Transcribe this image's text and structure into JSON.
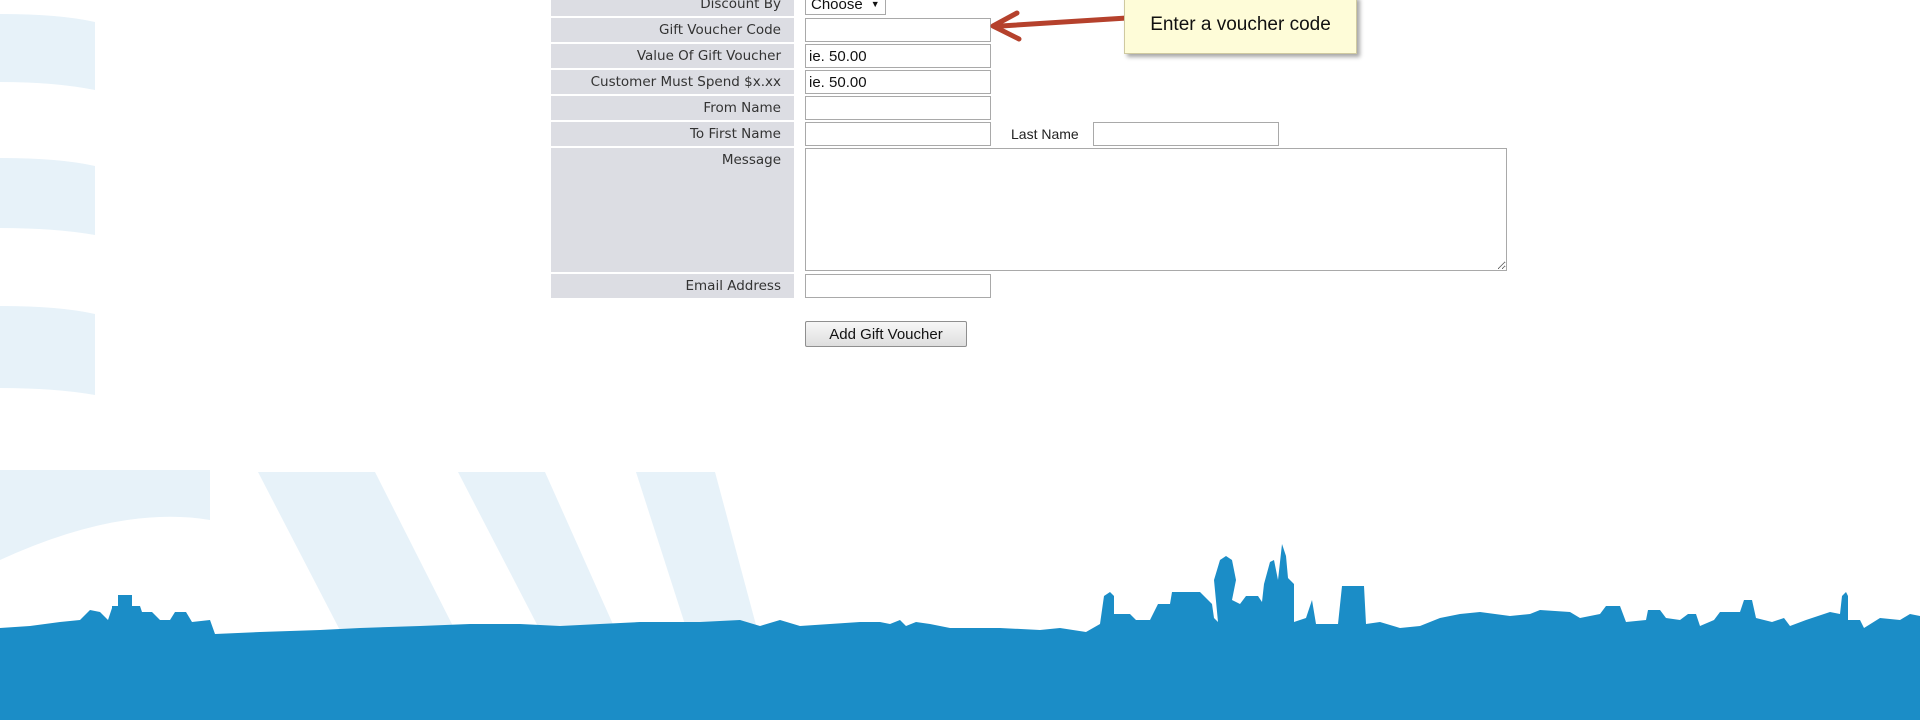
{
  "form": {
    "rows": [
      {
        "label": "Discount By",
        "select": "Choose"
      },
      {
        "label": "Gift Voucher Code",
        "value": ""
      },
      {
        "label": "Value Of Gift Voucher",
        "placeholder": "ie. 50.00"
      },
      {
        "label": "Customer Must Spend $x.xx",
        "placeholder": "ie. 50.00"
      },
      {
        "label": "From Name",
        "value": ""
      },
      {
        "label": "To First Name",
        "value": "",
        "extra_label": "Last Name"
      },
      {
        "label": "Message"
      },
      {
        "label": "Email Address",
        "value": ""
      }
    ],
    "submit_label": "Add Gift Voucher"
  },
  "callout": {
    "text": "Enter a voucher code",
    "arrow_color": "#b5412c"
  },
  "colors": {
    "label_bg": "#dcdde3",
    "skyline": "#1b8dc7",
    "arc": "#e3f0f8"
  }
}
